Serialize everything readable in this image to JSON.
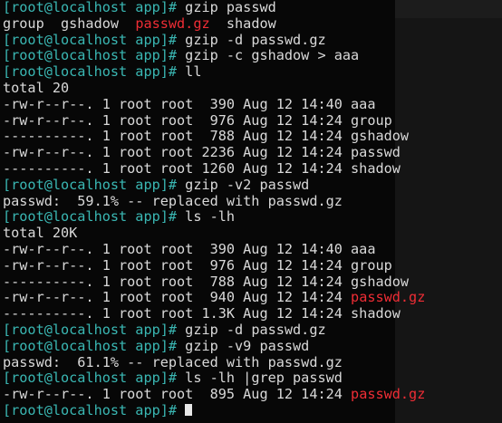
{
  "terminal": {
    "prompt": "[root@localhost app]# ",
    "lines": [
      {
        "kind": "prompt",
        "text": "gzip passwd"
      },
      {
        "kind": "listing",
        "parts": [
          {
            "text": "group  gshadow  ",
            "color": "out"
          },
          {
            "text": "passwd.gz",
            "color": "red"
          },
          {
            "text": "  shadow",
            "color": "out"
          }
        ]
      },
      {
        "kind": "prompt",
        "text": "gzip -d passwd.gz"
      },
      {
        "kind": "prompt",
        "text": "gzip -c gshadow > aaa"
      },
      {
        "kind": "prompt",
        "text": "ll"
      },
      {
        "kind": "text",
        "text": "total 20"
      },
      {
        "kind": "listing",
        "parts": [
          {
            "text": "-rw-r--r--. 1 root root  390 Aug 12 14:40 aaa",
            "color": "out"
          }
        ]
      },
      {
        "kind": "listing",
        "parts": [
          {
            "text": "-rw-r--r--. 1 root root  976 Aug 12 14:24 group",
            "color": "out"
          }
        ]
      },
      {
        "kind": "listing",
        "parts": [
          {
            "text": "----------. 1 root root  788 Aug 12 14:24 gshadow",
            "color": "out"
          }
        ]
      },
      {
        "kind": "listing",
        "parts": [
          {
            "text": "-rw-r--r--. 1 root root 2236 Aug 12 14:24 passwd",
            "color": "out"
          }
        ]
      },
      {
        "kind": "listing",
        "parts": [
          {
            "text": "----------. 1 root root 1260 Aug 12 14:24 shadow",
            "color": "out"
          }
        ]
      },
      {
        "kind": "prompt",
        "text": "gzip -v2 passwd"
      },
      {
        "kind": "text",
        "text": "passwd:  59.1% -- replaced with passwd.gz"
      },
      {
        "kind": "prompt",
        "text": "ls -lh"
      },
      {
        "kind": "text",
        "text": "total 20K"
      },
      {
        "kind": "listing",
        "parts": [
          {
            "text": "-rw-r--r--. 1 root root  390 Aug 12 14:40 aaa",
            "color": "out"
          }
        ]
      },
      {
        "kind": "listing",
        "parts": [
          {
            "text": "-rw-r--r--. 1 root root  976 Aug 12 14:24 group",
            "color": "out"
          }
        ]
      },
      {
        "kind": "listing",
        "parts": [
          {
            "text": "----------. 1 root root  788 Aug 12 14:24 gshadow",
            "color": "out"
          }
        ]
      },
      {
        "kind": "listing",
        "parts": [
          {
            "text": "-rw-r--r--. 1 root root  940 Aug 12 14:24 ",
            "color": "out"
          },
          {
            "text": "passwd.gz",
            "color": "red"
          }
        ]
      },
      {
        "kind": "listing",
        "parts": [
          {
            "text": "----------. 1 root root 1.3K Aug 12 14:24 shadow",
            "color": "out"
          }
        ]
      },
      {
        "kind": "prompt",
        "text": "gzip -d passwd.gz"
      },
      {
        "kind": "prompt",
        "text": "gzip -v9 passwd"
      },
      {
        "kind": "text",
        "text": "passwd:  61.1% -- replaced with passwd.gz"
      },
      {
        "kind": "prompt",
        "text": "ls -lh |grep passwd"
      },
      {
        "kind": "listing",
        "parts": [
          {
            "text": "-rw-r--r--. 1 root root  895 Aug 12 14:24 ",
            "color": "out"
          },
          {
            "text": "passwd.gz",
            "color": "red"
          }
        ]
      },
      {
        "kind": "cursor",
        "text": "[root@localhost app]# "
      }
    ]
  },
  "colors": {
    "background": "#070707",
    "prompt": "#3ab7b3",
    "text": "#d9d9d9",
    "archive": "#ef2d35",
    "panel": "#151515"
  }
}
